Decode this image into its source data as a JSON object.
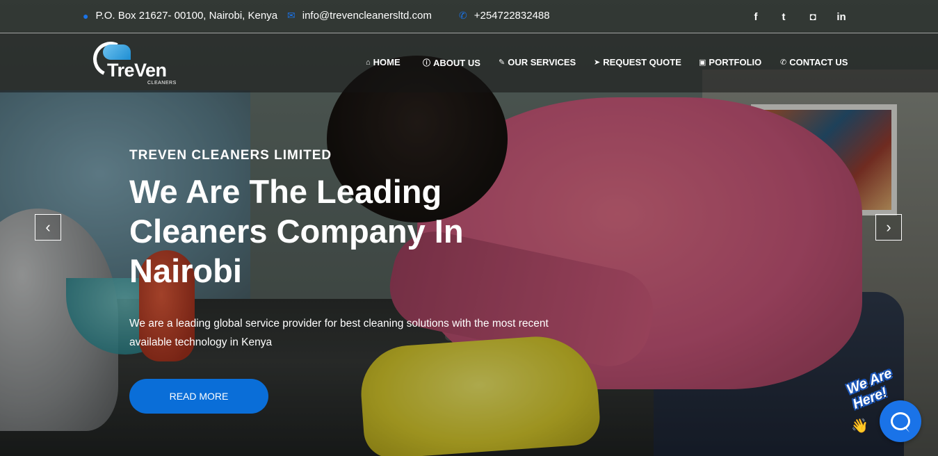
{
  "topbar": {
    "address": "P.O. Box 21627- 00100, Nairobi, Kenya",
    "email": "info@trevencleanersltd.com",
    "phone": "+254722832488",
    "social": [
      {
        "icon": "facebook-icon",
        "glyph": "f"
      },
      {
        "icon": "twitter-icon",
        "glyph": "t"
      },
      {
        "icon": "instagram-icon",
        "glyph": "◘"
      },
      {
        "icon": "linkedin-icon",
        "glyph": "in"
      }
    ]
  },
  "logo": {
    "name": "TreVen",
    "tagline": "CLEANERS"
  },
  "nav": {
    "items": [
      {
        "label": "HOME",
        "icon": "home-icon",
        "glyph": "⌂"
      },
      {
        "label": "ABOUT US",
        "icon": "info-icon",
        "glyph": "ⓘ"
      },
      {
        "label": "OUR SERVICES",
        "icon": "wrench-icon",
        "glyph": "✎"
      },
      {
        "label": "REQUEST QUOTE",
        "icon": "paper-plane-icon",
        "glyph": "➤"
      },
      {
        "label": "PORTFOLIO",
        "icon": "briefcase-icon",
        "glyph": "▣"
      },
      {
        "label": "CONTACT US",
        "icon": "phone-icon",
        "glyph": "✆"
      }
    ]
  },
  "hero": {
    "eyebrow": "TREVEN CLEANERS LIMITED",
    "headline": "We Are The Leading Cleaners Company In Nairobi",
    "subtext": "We are a leading global service provider for best cleaning solutions with the most recent available technology in Kenya",
    "cta": "READ MORE"
  },
  "carousel": {
    "prev_glyph": "‹",
    "next_glyph": "›"
  },
  "chat": {
    "label": "We Are Here!",
    "wave_glyph": "👋"
  },
  "colors": {
    "accent": "#0a6ed8",
    "icon_blue": "#1a73e8"
  }
}
